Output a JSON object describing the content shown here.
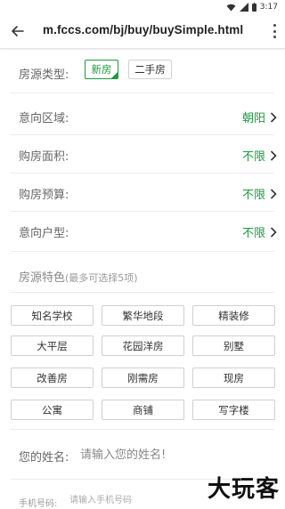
{
  "status_bar": {
    "time": "3:17",
    "icons": [
      "wifi-icon",
      "signal-icon",
      "battery-icon"
    ]
  },
  "browser": {
    "url": "m.fccs.com/bj/buy/buySimple.html",
    "back_icon": "back-arrow-icon",
    "menu_icon": "more-vert-icon"
  },
  "form": {
    "house_type": {
      "label": "房源类型:",
      "options": [
        {
          "label": "新房",
          "selected": true
        },
        {
          "label": "二手房",
          "selected": false
        }
      ]
    },
    "area": {
      "label": "意向区域:",
      "value": "朝阳"
    },
    "size": {
      "label": "购房面积:",
      "value": "不限"
    },
    "budget": {
      "label": "购房预算:",
      "value": "不限"
    },
    "layout": {
      "label": "意向户型:",
      "value": "不限"
    }
  },
  "features": {
    "title": "房源特色",
    "hint": "(最多可选择5项)",
    "tags": [
      "知名学校",
      "繁华地段",
      "精装修",
      "大平层",
      "花园洋房",
      "别墅",
      "改善房",
      "刚需房",
      "现房",
      "公寓",
      "商铺",
      "写字楼"
    ]
  },
  "contact": {
    "name_label": "您的姓名:",
    "name_placeholder": "请输入您的姓名!",
    "phone_label": "手机号码:",
    "phone_placeholder": "请输入手机号码"
  },
  "watermark": "大玩客",
  "colors": {
    "accent": "#1a9b3c",
    "label": "#666666",
    "border": "#cfcfcf"
  }
}
